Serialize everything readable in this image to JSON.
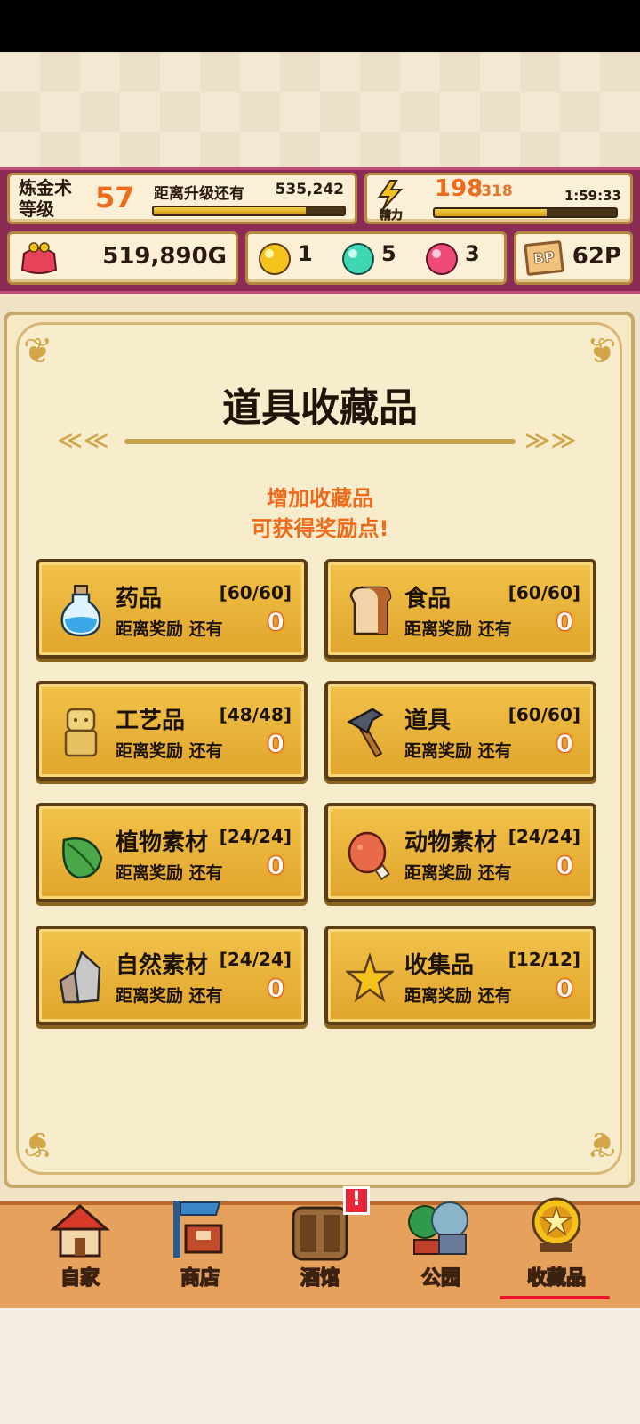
{
  "hud": {
    "alchemy_label": "炼金术\n等级",
    "alchemy_level": "57",
    "exp_label": "距离升级还有",
    "exp_remaining": "535,242",
    "exp_progress": 0.8,
    "stamina_icon_label": "精力",
    "stamina_current": "198",
    "stamina_max": "/318",
    "stamina_timer": "1:59:33",
    "stamina_progress": 0.62,
    "gold": "519,890G",
    "gem_yellow": "1",
    "gem_teal": "5",
    "gem_pink": "3",
    "bp_icon_label": "BP",
    "bp_points": "62P"
  },
  "page": {
    "title": "道具收藏品",
    "promo_line1": "增加收藏品",
    "promo_line2": "可获得奖励点!"
  },
  "cards": [
    {
      "name": "药品",
      "count": "[60/60]",
      "sub": "距离奖励 还有",
      "remaining": "0",
      "icon": "potion-icon"
    },
    {
      "name": "食品",
      "count": "[60/60]",
      "sub": "距离奖励 还有",
      "remaining": "0",
      "icon": "bread-icon"
    },
    {
      "name": "工艺品",
      "count": "[48/48]",
      "sub": "距离奖励 还有",
      "remaining": "0",
      "icon": "figurine-icon"
    },
    {
      "name": "道具",
      "count": "[60/60]",
      "sub": "距离奖励 还有",
      "remaining": "0",
      "icon": "hammer-icon"
    },
    {
      "name": "植物素材",
      "count": "[24/24]",
      "sub": "距离奖励 还有",
      "remaining": "0",
      "icon": "leaf-icon"
    },
    {
      "name": "动物素材",
      "count": "[24/24]",
      "sub": "距离奖励 还有",
      "remaining": "0",
      "icon": "meat-icon"
    },
    {
      "name": "自然素材",
      "count": "[24/24]",
      "sub": "距离奖励 还有",
      "remaining": "0",
      "icon": "stone-icon"
    },
    {
      "name": "收集品",
      "count": "[12/12]",
      "sub": "距离奖励 还有",
      "remaining": "0",
      "icon": "star-icon"
    }
  ],
  "nav": [
    {
      "label": "自家",
      "icon": "house-icon"
    },
    {
      "label": "商店",
      "icon": "shop-icon"
    },
    {
      "label": "酒馆",
      "icon": "tavern-icon"
    },
    {
      "label": "公园",
      "icon": "park-icon"
    },
    {
      "label": "收藏品",
      "icon": "collection-medal-icon"
    }
  ],
  "notification_badge": "!"
}
